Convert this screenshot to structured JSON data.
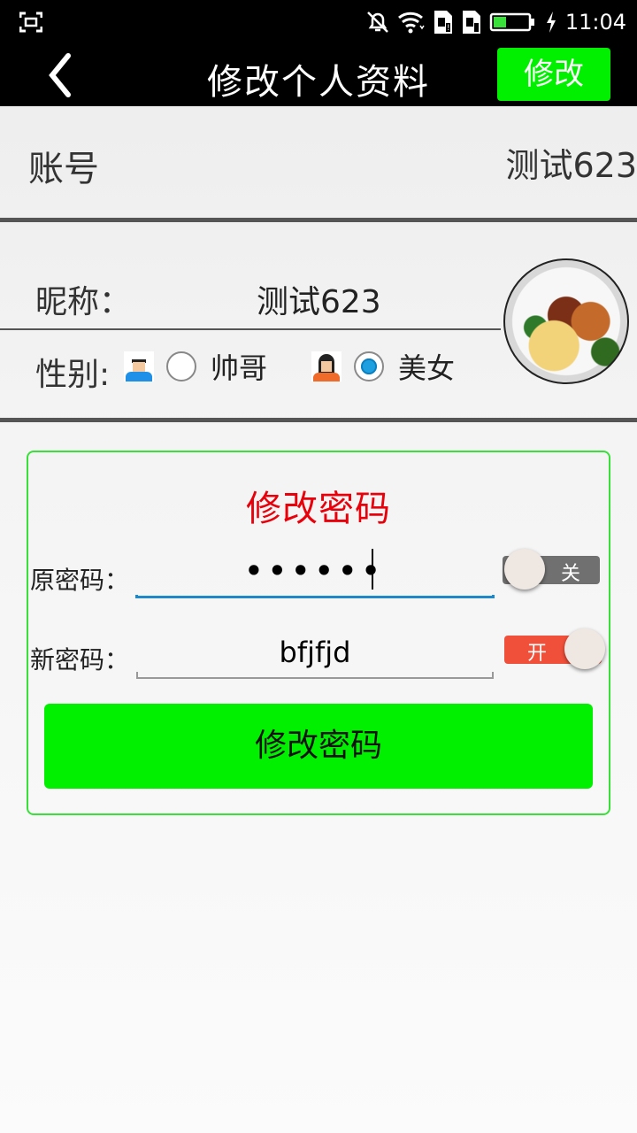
{
  "status_bar": {
    "time": "11:04",
    "icons": [
      "screenshot-icon",
      "mute-bell-icon",
      "wifi-icon",
      "sim1-icon",
      "sim2-icon",
      "battery-icon",
      "charging-icon"
    ]
  },
  "header": {
    "title": "修改个人资料",
    "back_icon": "chevron-left-icon",
    "edit_label": "修改"
  },
  "account": {
    "label": "账号",
    "value": "测试623"
  },
  "profile": {
    "nickname_label": "昵称：",
    "nickname_value": "测试623",
    "gender_label": "性别:",
    "gender_options": [
      {
        "label": "帅哥",
        "icon": "male-avatar-icon",
        "selected": false
      },
      {
        "label": "美女",
        "icon": "female-avatar-icon",
        "selected": true
      }
    ]
  },
  "password": {
    "title": "修改密码",
    "old_label": "原密码：",
    "old_value": "••••••",
    "old_toggle_label": "关",
    "new_label": "新密码：",
    "new_value": "bfjfjd",
    "new_toggle_label": "开",
    "submit_label": "修改密码"
  },
  "colors": {
    "accent_green": "#00f000",
    "title_red": "#e8000a",
    "toggle_on": "#f0503a",
    "toggle_off": "#707070",
    "input_focus": "#1e88c8"
  }
}
